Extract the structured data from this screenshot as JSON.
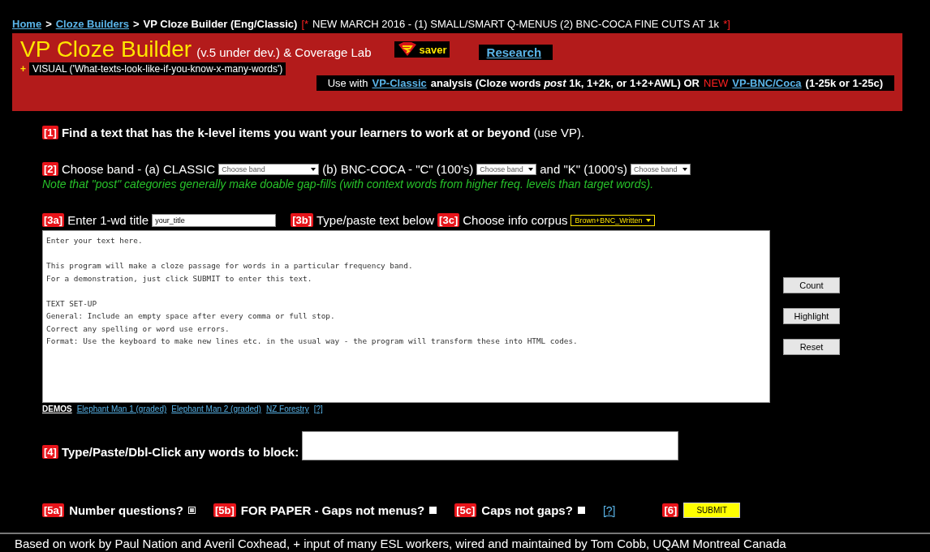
{
  "breadcrumb": {
    "links": [
      "Home",
      "Cloze Builders"
    ],
    "separator": ">",
    "current": "VP Cloze Builder (Eng/Classic)",
    "news_open": "[*",
    "news": "NEW MARCH 2016 - (1) SMALL/SMART Q-MENUS (2) BNC-COCA FINE CUTS AT 1k",
    "news_close": "*]"
  },
  "banner": {
    "title": "VP Cloze Builder",
    "subtitle": "(v.5 under dev.) & Coverage Lab",
    "saver": "saver",
    "research": "Research",
    "bullet": "+",
    "visual": "VISUAL ('What-texts-look-like-if-you-know-x-many-words')",
    "usage": {
      "lead": "Use with",
      "link1": "VP-Classic",
      "middle": "analysis (Cloze words *post* 1k, 1+2k, or 1+2+AWL)  OR",
      "new": "NEW",
      "link2": "VP-BNC/Coca",
      "tail": "(1-25k or 1-25c)"
    }
  },
  "step1": {
    "badge": "[1]",
    "text": "Find a text that has the k-level items you want your learners to work at or beyond",
    "suffix": "(use VP)."
  },
  "step2": {
    "badge": "[2]",
    "label_a": "Choose band - (a) CLASSIC",
    "select_a": "Choose band",
    "label_b": "(b) BNC-COCA - \"C\" (100's)",
    "select_b": "Choose band",
    "label_c": "and \"K\" (1000's)",
    "select_c": "Choose band",
    "note": "Note that \"post\" categories generally make doable gap-fills (with context words from higher freq. levels than target words)."
  },
  "step3": {
    "badge_a": "[3a]",
    "label_a": "Enter 1-wd title",
    "title_value": "your_title",
    "badge_b": "[3b]",
    "label_b": "Type/paste text below",
    "badge_c": "[3c]",
    "label_c": "Choose info corpus",
    "corpus": "Brown+BNC_Written"
  },
  "text_area": {
    "paragraphs": [
      [
        "Enter your text here."
      ],
      [
        "This program will make a cloze passage for words in a particular frequency band.",
        "For a demonstration, just click SUBMIT to enter this text."
      ],
      [
        "TEXT SET-UP",
        "General: Include an empty space after every comma or full stop.",
        "Correct any spelling or word use errors.",
        "Format: Use the keyboard to make new lines etc. in the usual way - the program will transform these into HTML codes."
      ]
    ]
  },
  "side_buttons": [
    "Count",
    "Highlight",
    "Reset"
  ],
  "demos": {
    "label": "DEMOS",
    "links": [
      "Elephant Man 1 (graded)",
      "Elephant Man 2 (graded)",
      "NZ Forestry",
      "[?]"
    ]
  },
  "step4": {
    "badge": "[4]",
    "label": "Type/Paste/Dbl-Click any words to block:"
  },
  "options": [
    {
      "badge": "[5a]",
      "label": "Number questions?",
      "checked": true
    },
    {
      "badge": "[5b]",
      "label": "FOR PAPER - Gaps not menus?",
      "checked": false
    },
    {
      "badge": "[5c]",
      "label": "Caps not gaps?",
      "checked": false
    }
  ],
  "help_link": "[?]",
  "submit": {
    "badge": "[6]",
    "label": "SUBMIT"
  },
  "footer": "Based on work by Paul Nation and Averil Coxhead, + input of many ESL workers, wired and maintained by Tom Cobb, UQAM Montreal Canada"
}
